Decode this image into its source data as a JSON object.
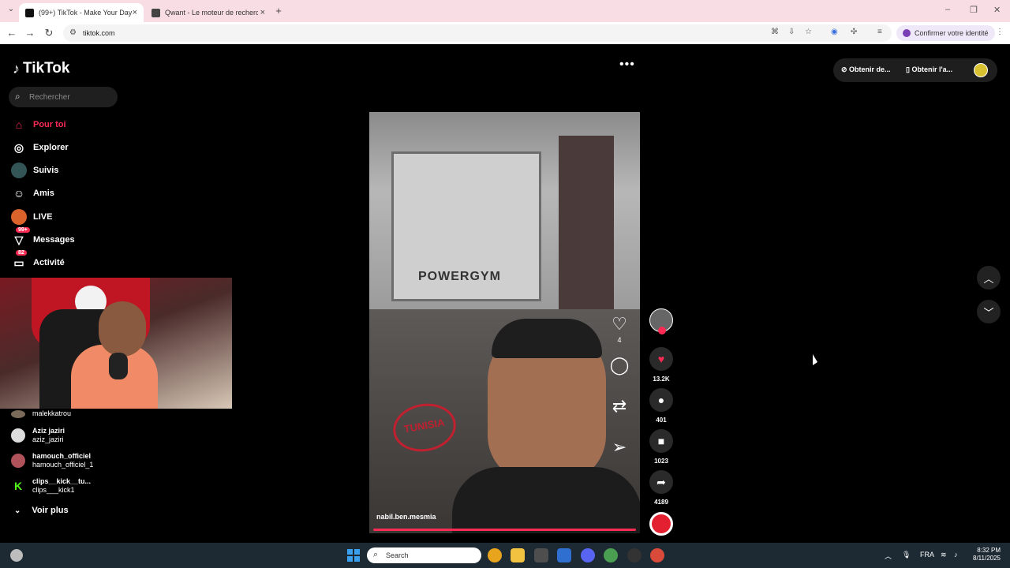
{
  "browser": {
    "tabs": [
      {
        "title": "(99+) TikTok - Make Your Day",
        "active": true
      },
      {
        "title": "Qwant - Le moteur de recherche",
        "active": false
      }
    ],
    "url": "tiktok.com",
    "identity_label": "Confirmer votre identité"
  },
  "sidebar": {
    "logo": "TikTok",
    "search_placeholder": "Rechercher",
    "nav": [
      {
        "label": "Pour toi",
        "icon": "home-icon",
        "active": true
      },
      {
        "label": "Explorer",
        "icon": "compass-icon"
      },
      {
        "label": "Suivis",
        "icon": "following-icon"
      },
      {
        "label": "Amis",
        "icon": "friends-icon"
      },
      {
        "label": "LIVE",
        "icon": "live-icon"
      },
      {
        "label": "Messages",
        "icon": "messages-icon",
        "badge": "99+"
      },
      {
        "label": "Activité",
        "icon": "activity-icon",
        "badge": "82"
      }
    ],
    "following": [
      {
        "name": "",
        "handle": "malekkatrou"
      },
      {
        "name": "Aziz jaziri",
        "handle": "aziz_jaziri"
      },
      {
        "name": "hamouch_officiel",
        "handle": "hamouch_officiel_1"
      },
      {
        "name": "clips__kick__tu...",
        "handle": "clips___kick1"
      }
    ],
    "see_more": "Voir plus"
  },
  "video": {
    "username": "nabil.ben.mesmia",
    "sign_text": "POWERGYM",
    "stamp_text": "TUNISIA",
    "like_count": "4",
    "progress": 1.0
  },
  "rail": {
    "likes": "13.2K",
    "comments": "401",
    "saves": "1023",
    "shares": "4189"
  },
  "topbar": {
    "get_coins": "Obtenir de...",
    "get_app": "Obtenir l'a..."
  },
  "taskbar": {
    "search_placeholder": "Search",
    "lang": "FRA",
    "time": "8:32 PM",
    "date": "8/11/2025"
  }
}
